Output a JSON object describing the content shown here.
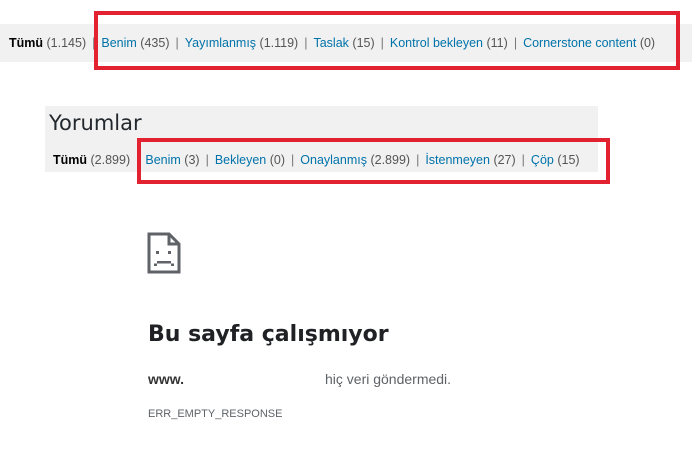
{
  "posts_filters": {
    "all": {
      "label": "Tümü",
      "count": "(1.145)"
    },
    "items": [
      {
        "label": "Benim",
        "count": "(435)"
      },
      {
        "label": "Yayımlanmış",
        "count": "(1.119)"
      },
      {
        "label": "Taslak",
        "count": "(15)"
      },
      {
        "label": "Kontrol bekleyen",
        "count": "(11)"
      },
      {
        "label": "Cornerstone content",
        "count": "(0)"
      }
    ],
    "separator": "|"
  },
  "comments": {
    "title": "Yorumlar",
    "all": {
      "label": "Tümü",
      "count": "(2.899)"
    },
    "items": [
      {
        "label": "Benim",
        "count": "(3)"
      },
      {
        "label": "Bekleyen",
        "count": "(0)"
      },
      {
        "label": "Onaylanmış",
        "count": "(2.899)"
      },
      {
        "label": "İstenmeyen",
        "count": "(27)"
      },
      {
        "label": "Çöp",
        "count": "(15)"
      }
    ],
    "separator": "|"
  },
  "error_page": {
    "icon": "sad-page-icon",
    "title": "Bu sayfa çalışmıyor",
    "host": "www.",
    "message": "hiç veri göndermedi.",
    "code": "ERR_EMPTY_RESPONSE"
  },
  "colors": {
    "link": "#0073aa",
    "highlight": "#e32231",
    "panel_bg": "#f1f1f1"
  }
}
